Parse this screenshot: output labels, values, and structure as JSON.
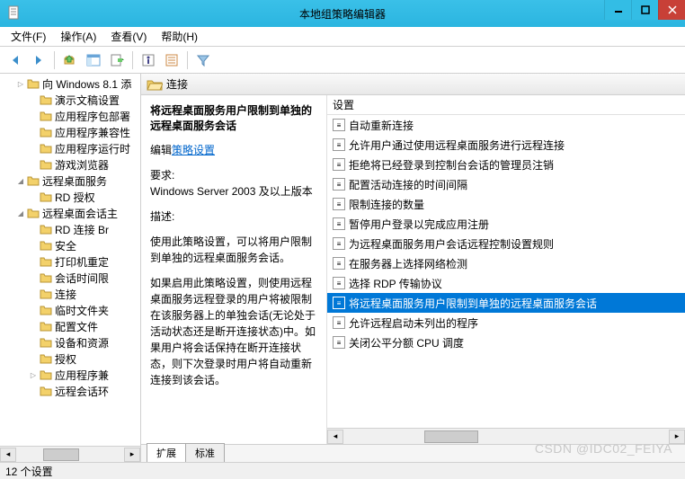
{
  "window": {
    "title": "本地组策略编辑器"
  },
  "menubar": {
    "file": "文件(F)",
    "action": "操作(A)",
    "view": "查看(V)",
    "help": "帮助(H)"
  },
  "tree": {
    "items": [
      {
        "ind": 1,
        "exp": "▷",
        "label": "向 Windows 8.1 添"
      },
      {
        "ind": 2,
        "exp": "",
        "label": "演示文稿设置"
      },
      {
        "ind": 2,
        "exp": "",
        "label": "应用程序包部署"
      },
      {
        "ind": 2,
        "exp": "",
        "label": "应用程序兼容性"
      },
      {
        "ind": 2,
        "exp": "",
        "label": "应用程序运行时"
      },
      {
        "ind": 2,
        "exp": "",
        "label": "游戏浏览器"
      },
      {
        "ind": 1,
        "exp": "◢",
        "label": "远程桌面服务"
      },
      {
        "ind": 2,
        "exp": "",
        "label": "RD 授权"
      },
      {
        "ind": 1,
        "exp": "◢",
        "label": "远程桌面会话主"
      },
      {
        "ind": 2,
        "exp": "",
        "label": "RD 连接 Br"
      },
      {
        "ind": 2,
        "exp": "",
        "label": "安全"
      },
      {
        "ind": 2,
        "exp": "",
        "label": "打印机重定"
      },
      {
        "ind": 2,
        "exp": "",
        "label": "会话时间限"
      },
      {
        "ind": 2,
        "exp": "",
        "label": "连接"
      },
      {
        "ind": 2,
        "exp": "",
        "label": "临时文件夹"
      },
      {
        "ind": 2,
        "exp": "",
        "label": "配置文件"
      },
      {
        "ind": 2,
        "exp": "",
        "label": "设备和资源"
      },
      {
        "ind": 2,
        "exp": "",
        "label": "授权"
      },
      {
        "ind": 2,
        "exp": "▷",
        "label": "应用程序兼"
      },
      {
        "ind": 2,
        "exp": "",
        "label": "远程会话环"
      }
    ]
  },
  "header": {
    "title": "连接"
  },
  "detail": {
    "title": "将远程桌面服务用户限制到单独的远程桌面服务会话",
    "edit_prefix": "编辑",
    "edit_link": "策略设置",
    "req_label": "要求:",
    "req_text": "Windows Server 2003 及以上版本",
    "desc_label": "描述:",
    "desc1": "使用此策略设置，可以将用户限制到单独的远程桌面服务会话。",
    "desc2": "如果启用此策略设置，则使用远程桌面服务远程登录的用户将被限制在该服务器上的单独会话(无论处于活动状态还是断开连接状态)中。如果用户将会话保持在断开连接状态，则下次登录时用户将自动重新连接到该会话。"
  },
  "list": {
    "header": "设置",
    "items": [
      "自动重新连接",
      "允许用户通过使用远程桌面服务进行远程连接",
      "拒绝将已经登录到控制台会话的管理员注销",
      "配置活动连接的时间间隔",
      "限制连接的数量",
      "暂停用户登录以完成应用注册",
      "为远程桌面服务用户会话远程控制设置规则",
      "在服务器上选择网络检测",
      "选择 RDP 传输协议",
      "将远程桌面服务用户限制到单独的远程桌面服务会话",
      "允许远程启动未列出的程序",
      "关闭公平分额 CPU 调度"
    ],
    "selected": 9
  },
  "tabs": {
    "ext": "扩展",
    "std": "标准"
  },
  "status": {
    "text": "12 个设置"
  },
  "watermark": "CSDN @IDC02_FEIYA"
}
